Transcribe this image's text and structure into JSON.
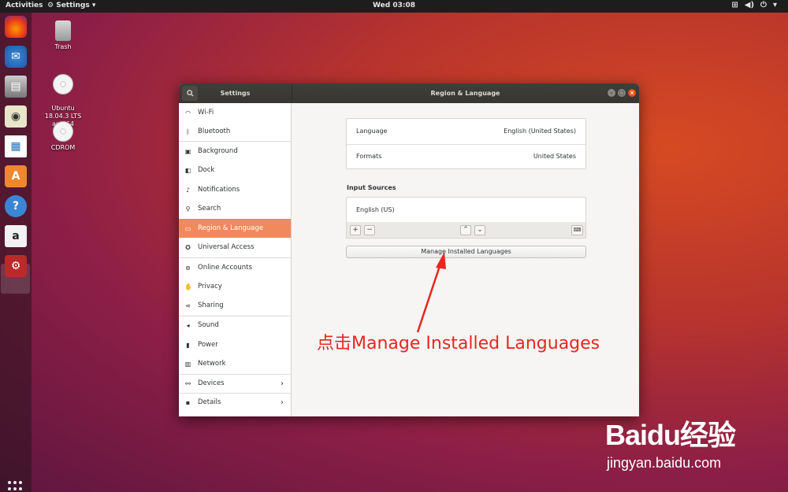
{
  "topbar": {
    "activities": "Activities",
    "app_menu": "Settings",
    "clock": "Wed 03:08"
  },
  "desktop": {
    "icons": [
      {
        "label": "Trash"
      },
      {
        "label": "Ubuntu\n18.04.3 LTS\namd64"
      },
      {
        "label": "CDROM"
      }
    ]
  },
  "window": {
    "left_title": "Settings",
    "right_title": "Region & Language"
  },
  "sidebar": {
    "items": [
      {
        "label": "Wi-Fi",
        "icon": "wifi-icon"
      },
      {
        "label": "Bluetooth",
        "icon": "bluetooth-icon"
      },
      {
        "label": "Background",
        "icon": "background-icon"
      },
      {
        "label": "Dock",
        "icon": "dock-icon"
      },
      {
        "label": "Notifications",
        "icon": "bell-icon"
      },
      {
        "label": "Search",
        "icon": "search-icon"
      },
      {
        "label": "Region & Language",
        "icon": "flag-icon",
        "active": true
      },
      {
        "label": "Universal Access",
        "icon": "accessibility-icon"
      },
      {
        "label": "Online Accounts",
        "icon": "accounts-icon"
      },
      {
        "label": "Privacy",
        "icon": "hand-icon"
      },
      {
        "label": "Sharing",
        "icon": "share-icon"
      },
      {
        "label": "Sound",
        "icon": "speaker-icon"
      },
      {
        "label": "Power",
        "icon": "power-icon"
      },
      {
        "label": "Network",
        "icon": "network-icon"
      },
      {
        "label": "Devices",
        "icon": "devices-icon",
        "chevron": true
      },
      {
        "label": "Details",
        "icon": "info-icon",
        "chevron": true
      }
    ]
  },
  "main": {
    "language": {
      "label": "Language",
      "value": "English (United States)"
    },
    "formats": {
      "label": "Formats",
      "value": "United States"
    },
    "input_sources_heading": "Input Sources",
    "input_sources": [
      "English (US)"
    ],
    "add_label": "+",
    "remove_label": "−",
    "manage_button": "Manage Installed Languages"
  },
  "annotation": {
    "text": "点击Manage Installed Languages",
    "color": "#e8261e"
  },
  "watermark": {
    "logo": "Baidu经验",
    "url": "jingyan.baidu.com"
  },
  "colors": {
    "accent": "#e95420",
    "sidebar_active": "#f08a5d"
  }
}
